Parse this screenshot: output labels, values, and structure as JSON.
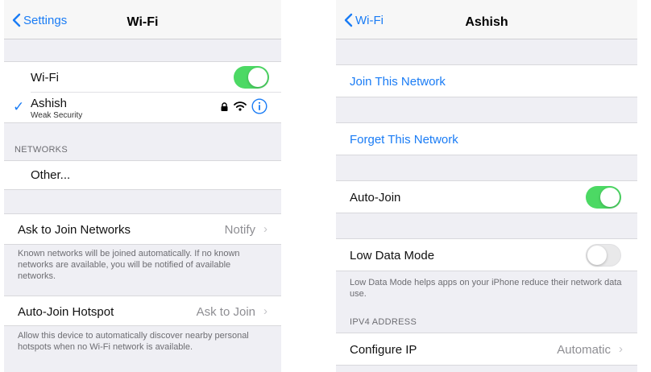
{
  "left": {
    "nav": {
      "back_label": "Settings",
      "title": "Wi-Fi"
    },
    "wifi_row": {
      "label": "Wi-Fi",
      "toggle": "on"
    },
    "current_network": {
      "name": "Ashish",
      "subtitle": "Weak Security",
      "checkmark": "✓"
    },
    "networks_header": "NETWORKS",
    "other_label": "Other...",
    "ask_join": {
      "label": "Ask to Join Networks",
      "value": "Notify"
    },
    "ask_join_footer": "Known networks will be joined automatically. If no known networks are available, you will be notified of available networks.",
    "hotspot": {
      "label": "Auto-Join Hotspot",
      "value": "Ask to Join"
    },
    "hotspot_footer": "Allow this device to automatically discover nearby personal hotspots when no Wi-Fi network is available."
  },
  "right": {
    "nav": {
      "back_label": "Wi-Fi",
      "title": "Ashish"
    },
    "join_label": "Join This Network",
    "forget_label": "Forget This Network",
    "auto_join": {
      "label": "Auto-Join",
      "toggle": "on"
    },
    "low_data": {
      "label": "Low Data Mode",
      "toggle": "off"
    },
    "low_data_footer": "Low Data Mode helps apps on your iPhone reduce their network data use.",
    "ipv4_header": "IPV4 ADDRESS",
    "configure_ip": {
      "label": "Configure IP",
      "value": "Automatic"
    }
  },
  "colors": {
    "accent": "#1a7cf5",
    "toggle_on": "#4cd964",
    "background": "#efeff4"
  },
  "icons": [
    "chevron-left-icon",
    "checkmark-icon",
    "lock-icon",
    "wifi-signal-icon",
    "info-icon",
    "chevron-right-icon"
  ]
}
